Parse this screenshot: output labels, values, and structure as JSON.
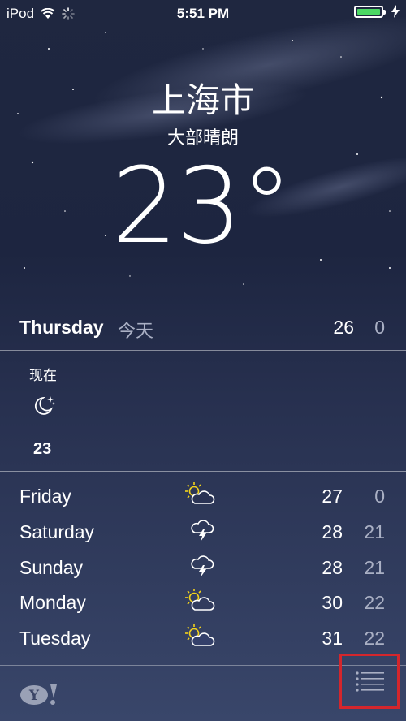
{
  "status_bar": {
    "carrier": "iPod",
    "time": "5:51 PM",
    "icons": [
      "wifi-icon",
      "activity-spinner-icon",
      "charging-bolt-icon",
      "battery-icon"
    ],
    "battery_color": "#4cd964"
  },
  "location": {
    "city": "上海市",
    "condition": "大部晴朗",
    "temperature": "23°"
  },
  "today": {
    "day": "Thursday",
    "label": "今天",
    "high": "26",
    "low": "0"
  },
  "hourly": [
    {
      "time": "现在",
      "icon": "moon-stars-icon",
      "temp": "23"
    }
  ],
  "forecast": [
    {
      "day": "Friday",
      "icon": "partly-sunny-icon",
      "high": "27",
      "low": "0"
    },
    {
      "day": "Saturday",
      "icon": "thunderstorm-icon",
      "high": "28",
      "low": "21"
    },
    {
      "day": "Sunday",
      "icon": "thunderstorm-icon",
      "high": "28",
      "low": "21"
    },
    {
      "day": "Monday",
      "icon": "partly-sunny-icon",
      "high": "30",
      "low": "22"
    },
    {
      "day": "Tuesday",
      "icon": "partly-sunny-icon",
      "high": "31",
      "low": "22"
    }
  ],
  "bottom_bar": {
    "logo": "yahoo-logo",
    "list_button_icon": "list-icon",
    "highlight_color": "#d4262c"
  }
}
